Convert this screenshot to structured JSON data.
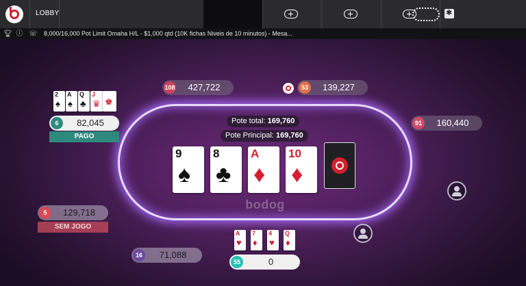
{
  "topbar": {
    "lobby_label": "LOBBY"
  },
  "infobar": {
    "table_info": "8,000/16,000 Pot Limit Omaha H/L - $1,000 qtd (10K fichas Niveis de 10 minutos) - Mesa..."
  },
  "table": {
    "pot_total_label": "Pote total:",
    "pot_total_value": "169,760",
    "pot_main_label": "Pote Principal:",
    "pot_main_value": "169,760",
    "brand": "bodog",
    "board": [
      {
        "rank": "9",
        "suit": "♠",
        "color": "black"
      },
      {
        "rank": "8",
        "suit": "♣",
        "color": "black"
      },
      {
        "rank": "A",
        "suit": "♦",
        "color": "red"
      },
      {
        "rank": "10",
        "suit": "♦",
        "color": "red"
      }
    ]
  },
  "players": [
    {
      "seat": "108",
      "stack": "427,722",
      "color": "#c8445a"
    },
    {
      "seat": "53",
      "stack": "139,227",
      "color": "#e07048"
    },
    {
      "seat": "91",
      "stack": "160,440",
      "color": "#d04a6a"
    },
    {
      "seat": "6",
      "stack": "82,045",
      "color": "#2e8a7e",
      "status": "PAGO",
      "cards": [
        "2",
        "A",
        "Q",
        "J"
      ]
    },
    {
      "seat": "5",
      "stack": "129,718",
      "color": "#d84a56",
      "status": "SEM JOGO"
    },
    {
      "seat": "16",
      "stack": "71,088",
      "color": "#6a4aa0"
    },
    {
      "seat": "55",
      "stack": "0",
      "color": "#28c0b4",
      "cards": [
        "A",
        "7",
        "4",
        "Q"
      ]
    }
  ],
  "colors": {
    "brand_red": "#d21f2b",
    "paid_status": "#2e8a7e",
    "fold_status": "#c24a5a"
  }
}
